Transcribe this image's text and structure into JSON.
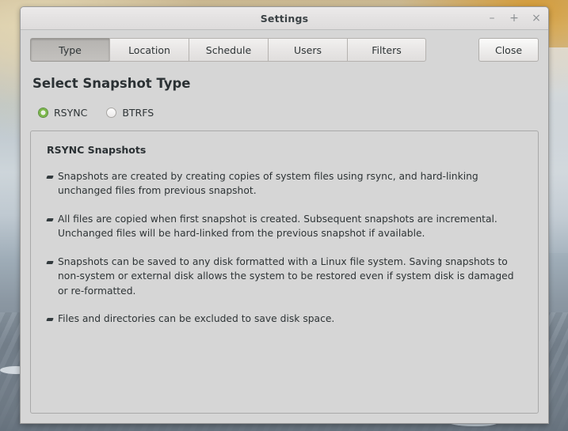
{
  "window": {
    "title": "Settings",
    "controls": [
      {
        "name": "minimize",
        "glyph": "–"
      },
      {
        "name": "maximize",
        "glyph": "+"
      },
      {
        "name": "close",
        "glyph": "×"
      }
    ]
  },
  "tabs": [
    {
      "label": "Type",
      "active": true
    },
    {
      "label": "Location",
      "active": false
    },
    {
      "label": "Schedule",
      "active": false
    },
    {
      "label": "Users",
      "active": false
    },
    {
      "label": "Filters",
      "active": false
    }
  ],
  "close_button": {
    "label": "Close"
  },
  "page": {
    "title": "Select Snapshot Type"
  },
  "snapshot_type": {
    "selected": "RSYNC",
    "options": [
      {
        "label": "RSYNC",
        "checked": true
      },
      {
        "label": "BTRFS",
        "checked": false
      }
    ]
  },
  "info": {
    "heading": "RSYNC Snapshots",
    "bullets": [
      "Snapshots are created by creating copies of system files using rsync, and hard-linking unchanged files from previous snapshot.",
      "All files are copied when first snapshot is created. Subsequent snapshots are incremental. Unchanged files will be hard-linked from the previous snapshot if available.",
      "Snapshots can be saved to any disk formatted with a Linux file system. Saving snapshots to non-system or external disk allows the system to be restored even if system disk is damaged or re-formatted.",
      "Files and directories can be excluded to save disk space."
    ]
  },
  "colors": {
    "window_bg": "#d6d6d6",
    "titlebar_bg": "#e6e4e4",
    "accent_green": "#7ab648",
    "text": "#2e3436",
    "border": "#a9a9a9"
  }
}
